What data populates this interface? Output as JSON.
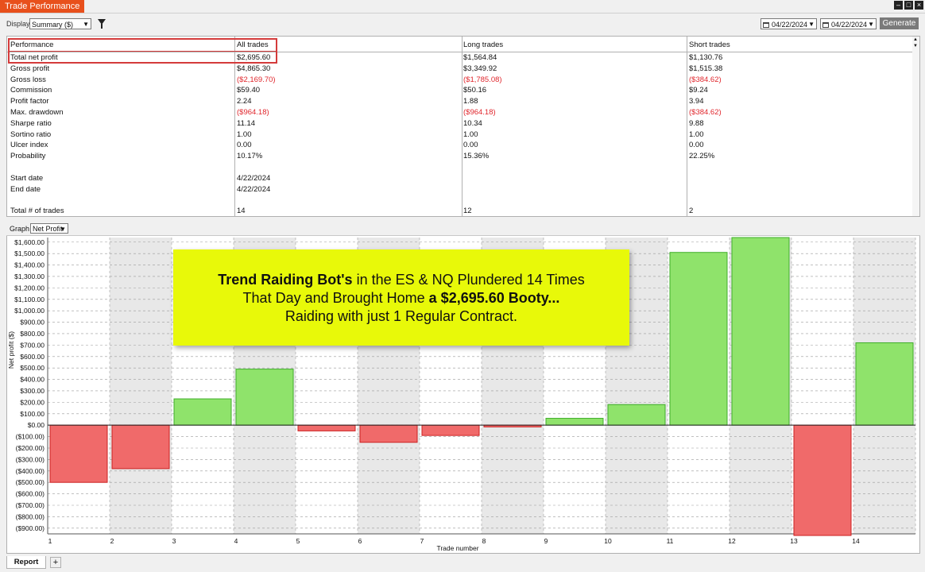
{
  "window": {
    "title": "Trade Performance"
  },
  "toolbar": {
    "display_label": "Display",
    "display_value": "Summary ($)",
    "date_from": "04/22/2024",
    "date_to": "04/22/2024",
    "generate_label": "Generate"
  },
  "table": {
    "headers": [
      "Performance",
      "All trades",
      "Long trades",
      "Short trades"
    ],
    "rows": [
      {
        "label": "Total net profit",
        "all": "$2,695.60",
        "long": "$1,564.84",
        "short": "$1,130.76"
      },
      {
        "label": "Gross profit",
        "all": "$4,865.30",
        "long": "$3,349.92",
        "short": "$1,515.38"
      },
      {
        "label": "Gross loss",
        "all": "($2,169.70)",
        "long": "($1,785.08)",
        "short": "($384.62)"
      },
      {
        "label": "Commission",
        "all": "$59.40",
        "long": "$50.16",
        "short": "$9.24"
      },
      {
        "label": "Profit factor",
        "all": "2.24",
        "long": "1.88",
        "short": "3.94"
      },
      {
        "label": "Max. drawdown",
        "all": "($964.18)",
        "long": "($964.18)",
        "short": "($384.62)"
      },
      {
        "label": "Sharpe ratio",
        "all": "11.14",
        "long": "10.34",
        "short": "9.88"
      },
      {
        "label": "Sortino ratio",
        "all": "1.00",
        "long": "1.00",
        "short": "1.00"
      },
      {
        "label": "Ulcer index",
        "all": "0.00",
        "long": "0.00",
        "short": "0.00"
      },
      {
        "label": "Probability",
        "all": "10.17%",
        "long": "15.36%",
        "short": "22.25%"
      },
      {
        "label": "",
        "all": "",
        "long": "",
        "short": ""
      },
      {
        "label": "Start date",
        "all": "4/22/2024",
        "long": "",
        "short": ""
      },
      {
        "label": "End date",
        "all": "4/22/2024",
        "long": "",
        "short": ""
      },
      {
        "label": "",
        "all": "",
        "long": "",
        "short": ""
      },
      {
        "label": "Total # of trades",
        "all": "14",
        "long": "12",
        "short": "2"
      }
    ]
  },
  "graph": {
    "label": "Graph",
    "select_value": "Net Profit"
  },
  "chart_data": {
    "type": "bar",
    "ylabel": "Net profit ($)",
    "xlabel": "Trade number",
    "ylim": [
      -950,
      1640
    ],
    "yticks": [
      -900,
      -800,
      -700,
      -600,
      -500,
      -400,
      -300,
      -200,
      -100,
      0,
      100,
      200,
      300,
      400,
      500,
      600,
      700,
      800,
      900,
      1000,
      1100,
      1200,
      1300,
      1400,
      1500,
      1600
    ],
    "ytick_labels": [
      "($900.00)",
      "($800.00)",
      "($700.00)",
      "($600.00)",
      "($500.00)",
      "($400.00)",
      "($300.00)",
      "($200.00)",
      "($100.00)",
      "$0.00",
      "$100.00",
      "$200.00",
      "$300.00",
      "$400.00",
      "$500.00",
      "$600.00",
      "$700.00",
      "$800.00",
      "$900.00",
      "$1,000.00",
      "$1,100.00",
      "$1,200.00",
      "$1,300.00",
      "$1,400.00",
      "$1,500.00",
      "$1,600.00"
    ],
    "x": [
      1,
      2,
      3,
      4,
      5,
      6,
      7,
      8,
      9,
      10,
      11,
      12,
      13,
      14
    ],
    "values": [
      -500,
      -380,
      230,
      490,
      -50,
      -150,
      -90,
      -15,
      60,
      180,
      1510,
      1640,
      -964,
      720
    ],
    "colors": {
      "positive": "#8fe36b",
      "negative": "#f06a6a",
      "positive_border": "#3fae2a",
      "negative_border": "#cc2020"
    },
    "grid": true
  },
  "banner": {
    "line1_bold": "Trend Raiding Bot's",
    "line1_rest": " in the ES & NQ Plundered 14 Times",
    "line2_plain": "That Day and Brought Home ",
    "line2_bold": "a $2,695.60 Booty...",
    "line3": "Raiding with just 1 Regular Contract."
  },
  "tabs": {
    "report": "Report",
    "add": "+"
  },
  "icons": {
    "filter": "filter-icon",
    "calendar": "calendar-icon",
    "minimize": "minimize-icon",
    "maximize": "maximize-icon",
    "close": "close-icon"
  }
}
